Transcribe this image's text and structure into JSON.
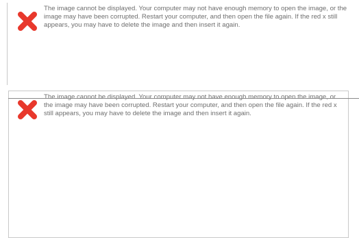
{
  "placeholders": [
    {
      "icon": "red-x-icon",
      "message": "The image cannot be displayed. Your computer may not have enough memory to open the image, or the image may have been corrupted. Restart your computer, and then open the file again. If the red x still appears, you may have to delete the image and then insert it again."
    },
    {
      "icon": "red-x-icon",
      "message": "The image cannot be displayed. Your computer may not have enough memory to open the image, or the image may have been corrupted. Restart your computer, and then open the file again. If the red x still appears, you may have to delete the image and then insert it again."
    }
  ],
  "colors": {
    "x_red": "#e8382c",
    "text": "#6e6e6e",
    "frame": "#c8c8c8"
  }
}
